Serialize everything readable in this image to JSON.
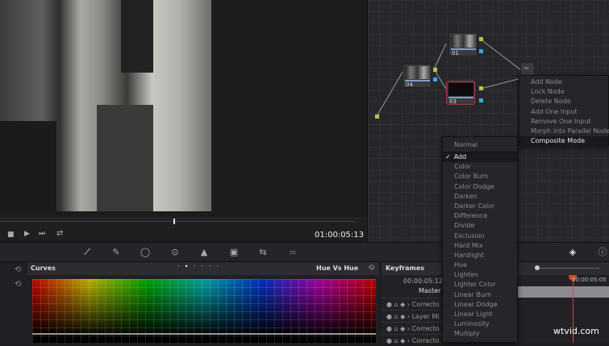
{
  "viewer": {
    "timecode": "01:00:05:13"
  },
  "nodes": [
    {
      "label": "01"
    },
    {
      "label": "04"
    },
    {
      "label": "03"
    }
  ],
  "context_menu": {
    "items": [
      "Add Node",
      "Lock Node",
      "Delete Node",
      "Add One Input",
      "Remove One Input",
      "Morph into Parallel Node",
      "Composite Mode"
    ],
    "active": "Composite Mode"
  },
  "composite_menu": {
    "items": [
      "Normal",
      "Add",
      "Color",
      "Color Burn",
      "Color Dodge",
      "Darken",
      "Darker Color",
      "Difference",
      "Divide",
      "Exclusion",
      "Hard Mix",
      "Hardlight",
      "Hue",
      "Lighten",
      "Lighter Color",
      "Linear Burn",
      "Linear Dodge",
      "Linear Light",
      "Luminosity",
      "Multiply"
    ],
    "selected": "Add",
    "check": "✓"
  },
  "curves": {
    "title": "Curves",
    "mode": "Hue Vs Hue"
  },
  "keyframes": {
    "title": "Keyframes",
    "timecode": "00:00:05:12",
    "master": "Master",
    "playhead_time": "00:00:05:05",
    "rows": [
      "Correcto",
      "Layer Mi",
      "Correcto",
      "Correcto"
    ]
  },
  "watermark": "wtvid.com",
  "colors": {
    "accent": "#a4d23a",
    "playhead": "#e0402a"
  }
}
